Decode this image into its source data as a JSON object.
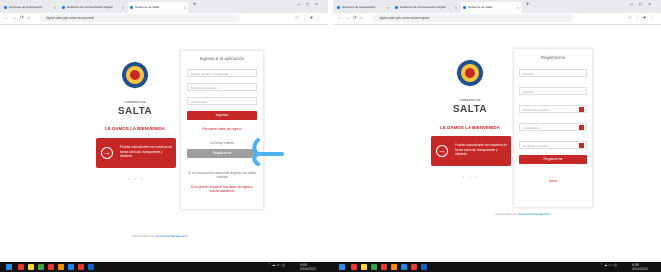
{
  "shots": [
    {
      "tabs": [
        {
          "label": "Acciones de la Actuación"
        },
        {
          "label": "Gobierno de Comunicación Digital"
        },
        {
          "label": "Gobierno de Salta"
        }
      ],
      "url": "digital.salta.gob.ar/servicios/portal",
      "brand": {
        "gobierno": "GOBIERNO DE",
        "salta": "SALTA"
      },
      "welcome": "LE DAMOS LA BIENVENIDA",
      "promo_text": "Podrás comunicarte con nosotros de forma cómoda, transparente y eficiente.",
      "dots": "• • •",
      "login": {
        "title": "Ingresa a la aplicación",
        "user_placeholder": "Correo usuario o credencial",
        "user2_placeholder": "Nombre de usuario",
        "password_placeholder": "Contraseña",
        "login_button": "Ingresar",
        "forgot_link": "Recuperar datos de ingreso",
        "no_account": "No tengo cuenta",
        "register_button": "Registrarme",
        "help_text": "Si no se encuentra disponible ingreso con estas cuentas",
        "recover_link": "Si no puede recuperar sus datos de ingreso, solicite asistencia"
      },
      "footer": {
        "prefix": "Desarrollado por",
        "org": "Secretaría Management"
      }
    },
    {
      "tabs": [
        {
          "label": "Acciones de la Actuación"
        },
        {
          "label": "Gobierno de Comunicación Digital"
        },
        {
          "label": "Gobierno de Salta"
        }
      ],
      "url": "digital.salta.gob.ar/servicios/registro",
      "brand": {
        "gobierno": "GOBIERNO DE",
        "salta": "SALTA"
      },
      "welcome": "LE DAMOS LA BIENVENIDA",
      "promo_text": "Podrás comunicarte con nosotros de forma cómoda, transparente y eficiente.",
      "dots": "• • •",
      "register": {
        "title": "Registrarme",
        "name_placeholder": "Nombre",
        "surname_placeholder": "Apellido",
        "username_placeholder": "Nombre de usuario",
        "password_placeholder": "Contraseña",
        "email_placeholder": "E-mail de contacto",
        "register_button": "Registrarme",
        "back_link": "Volver"
      },
      "footer": {
        "prefix": "Desarrollado por",
        "org": "Secretaría Management"
      }
    }
  ],
  "taskbar": {
    "left_clock": "9:55\n20/4/2023",
    "right_clock": "9:55\n20/4/2023"
  },
  "colors": {
    "brand_red": "#c62828",
    "annotation_blue": "#4fb3f0"
  }
}
